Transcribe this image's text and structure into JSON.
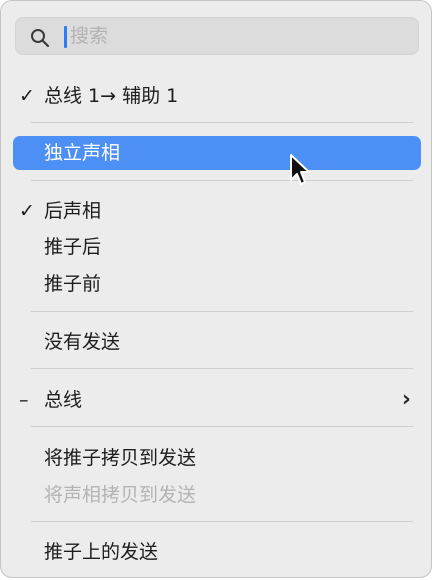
{
  "search": {
    "placeholder": "搜索",
    "icon": "magnifier-icon"
  },
  "menu": {
    "routing": {
      "check": "✓",
      "label": "总线 1→ 辅助 1"
    },
    "independent_pan": {
      "label": "独立声相"
    },
    "post_pan": {
      "check": "✓",
      "label": "后声相"
    },
    "post_fader": {
      "label": "推子后"
    },
    "pre_fader": {
      "label": "推子前"
    },
    "no_send": {
      "label": "没有发送"
    },
    "bus": {
      "check": "–",
      "label": "总线",
      "chevron": "›"
    },
    "copy_fader": {
      "label": "将推子拷贝到发送"
    },
    "copy_pan": {
      "label": "将声相拷贝到发送"
    },
    "fader_sends": {
      "label": "推子上的发送"
    }
  },
  "colors": {
    "highlight": "#4d90f5",
    "background": "#ececec",
    "caret": "#2f7df6"
  }
}
